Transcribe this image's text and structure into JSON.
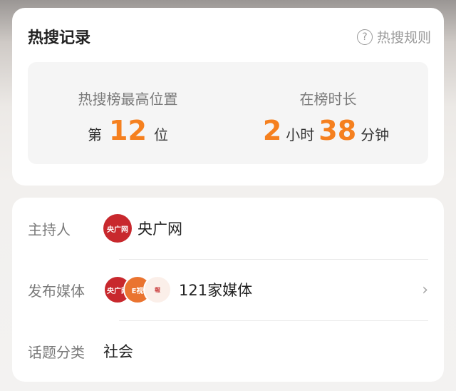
{
  "record": {
    "title": "热搜记录",
    "rules_label": "热搜规则",
    "rules_icon": "question-circle-icon",
    "peak": {
      "label": "热搜榜最高位置",
      "prefix": "第",
      "value": "12",
      "suffix": "位"
    },
    "duration": {
      "label": "在榜时长",
      "hours": "2",
      "hours_unit": "小时",
      "minutes": "38",
      "minutes_unit": "分钟"
    }
  },
  "info": {
    "host": {
      "label": "主持人",
      "name": "央广网",
      "logo_text": "央广网"
    },
    "publishers": {
      "label": "发布媒体",
      "value": "121家媒体",
      "logos": [
        "央广网",
        "E视",
        "報"
      ]
    },
    "category": {
      "label": "话题分类",
      "value": "社会"
    }
  },
  "colors": {
    "accent": "#f5801f",
    "cnr_red": "#c8282d"
  }
}
